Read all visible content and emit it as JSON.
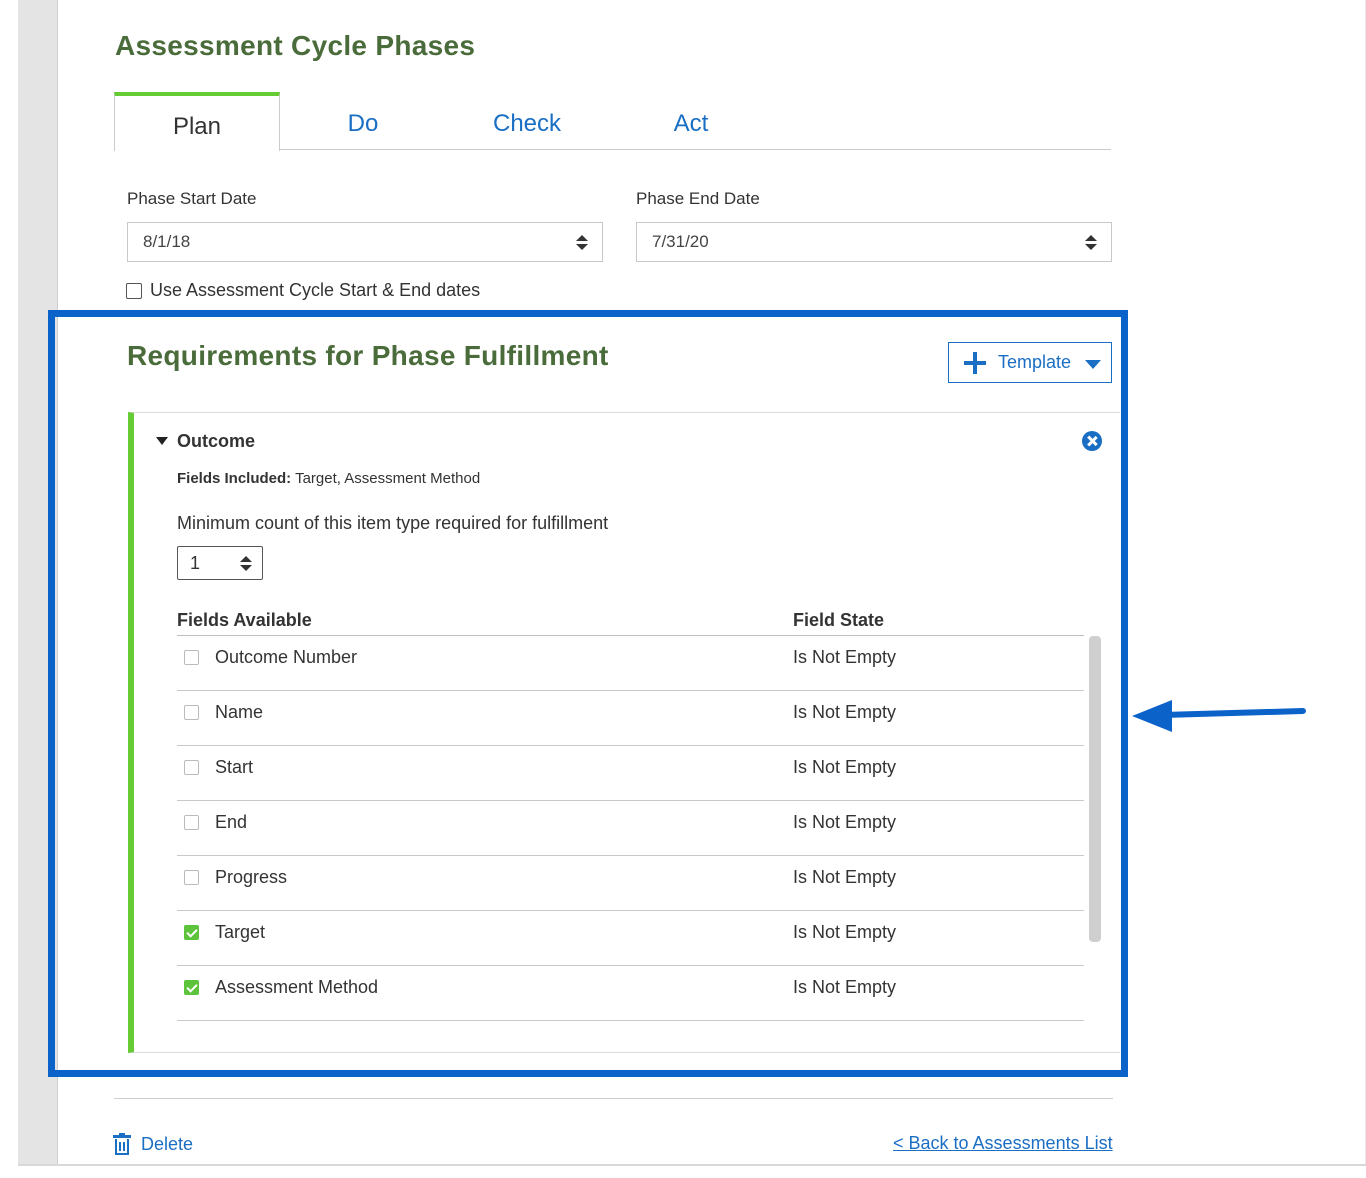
{
  "page": {
    "title": "Assessment Cycle Phases"
  },
  "tabs": [
    {
      "label": "Plan",
      "active": true
    },
    {
      "label": "Do",
      "active": false
    },
    {
      "label": "Check",
      "active": false
    },
    {
      "label": "Act",
      "active": false
    }
  ],
  "dates": {
    "start_label": "Phase Start Date",
    "start_value": "8/1/18",
    "end_label": "Phase End Date",
    "end_value": "7/31/20",
    "use_cycle_label": "Use Assessment Cycle Start & End dates",
    "use_cycle_checked": false
  },
  "requirements": {
    "title": "Requirements for Phase Fulfillment",
    "template_button": "Template"
  },
  "outcome": {
    "title": "Outcome",
    "fields_included_label": "Fields Included:",
    "fields_included_value": " Target, Assessment Method",
    "min_count_label": "Minimum count of this item type required for fulfillment",
    "min_count_value": "1",
    "col_fields": "Fields Available",
    "col_state": "Field State",
    "rows": [
      {
        "name": "Outcome Number",
        "state": "Is Not Empty",
        "checked": false
      },
      {
        "name": "Name",
        "state": "Is Not Empty",
        "checked": false
      },
      {
        "name": "Start",
        "state": "Is Not Empty",
        "checked": false
      },
      {
        "name": "End",
        "state": "Is Not Empty",
        "checked": false
      },
      {
        "name": "Progress",
        "state": "Is Not Empty",
        "checked": false
      },
      {
        "name": "Target",
        "state": "Is Not Empty",
        "checked": true
      },
      {
        "name": "Assessment Method",
        "state": "Is Not Empty",
        "checked": true
      }
    ]
  },
  "footer": {
    "delete_label": "Delete",
    "back_label": "< Back to Assessments List"
  },
  "colors": {
    "accent_blue": "#1a6ec4",
    "highlight_blue": "#0b62c9",
    "heading_green": "#4a6b3a",
    "tab_green": "#66cc33",
    "check_green": "#5cc33b"
  }
}
